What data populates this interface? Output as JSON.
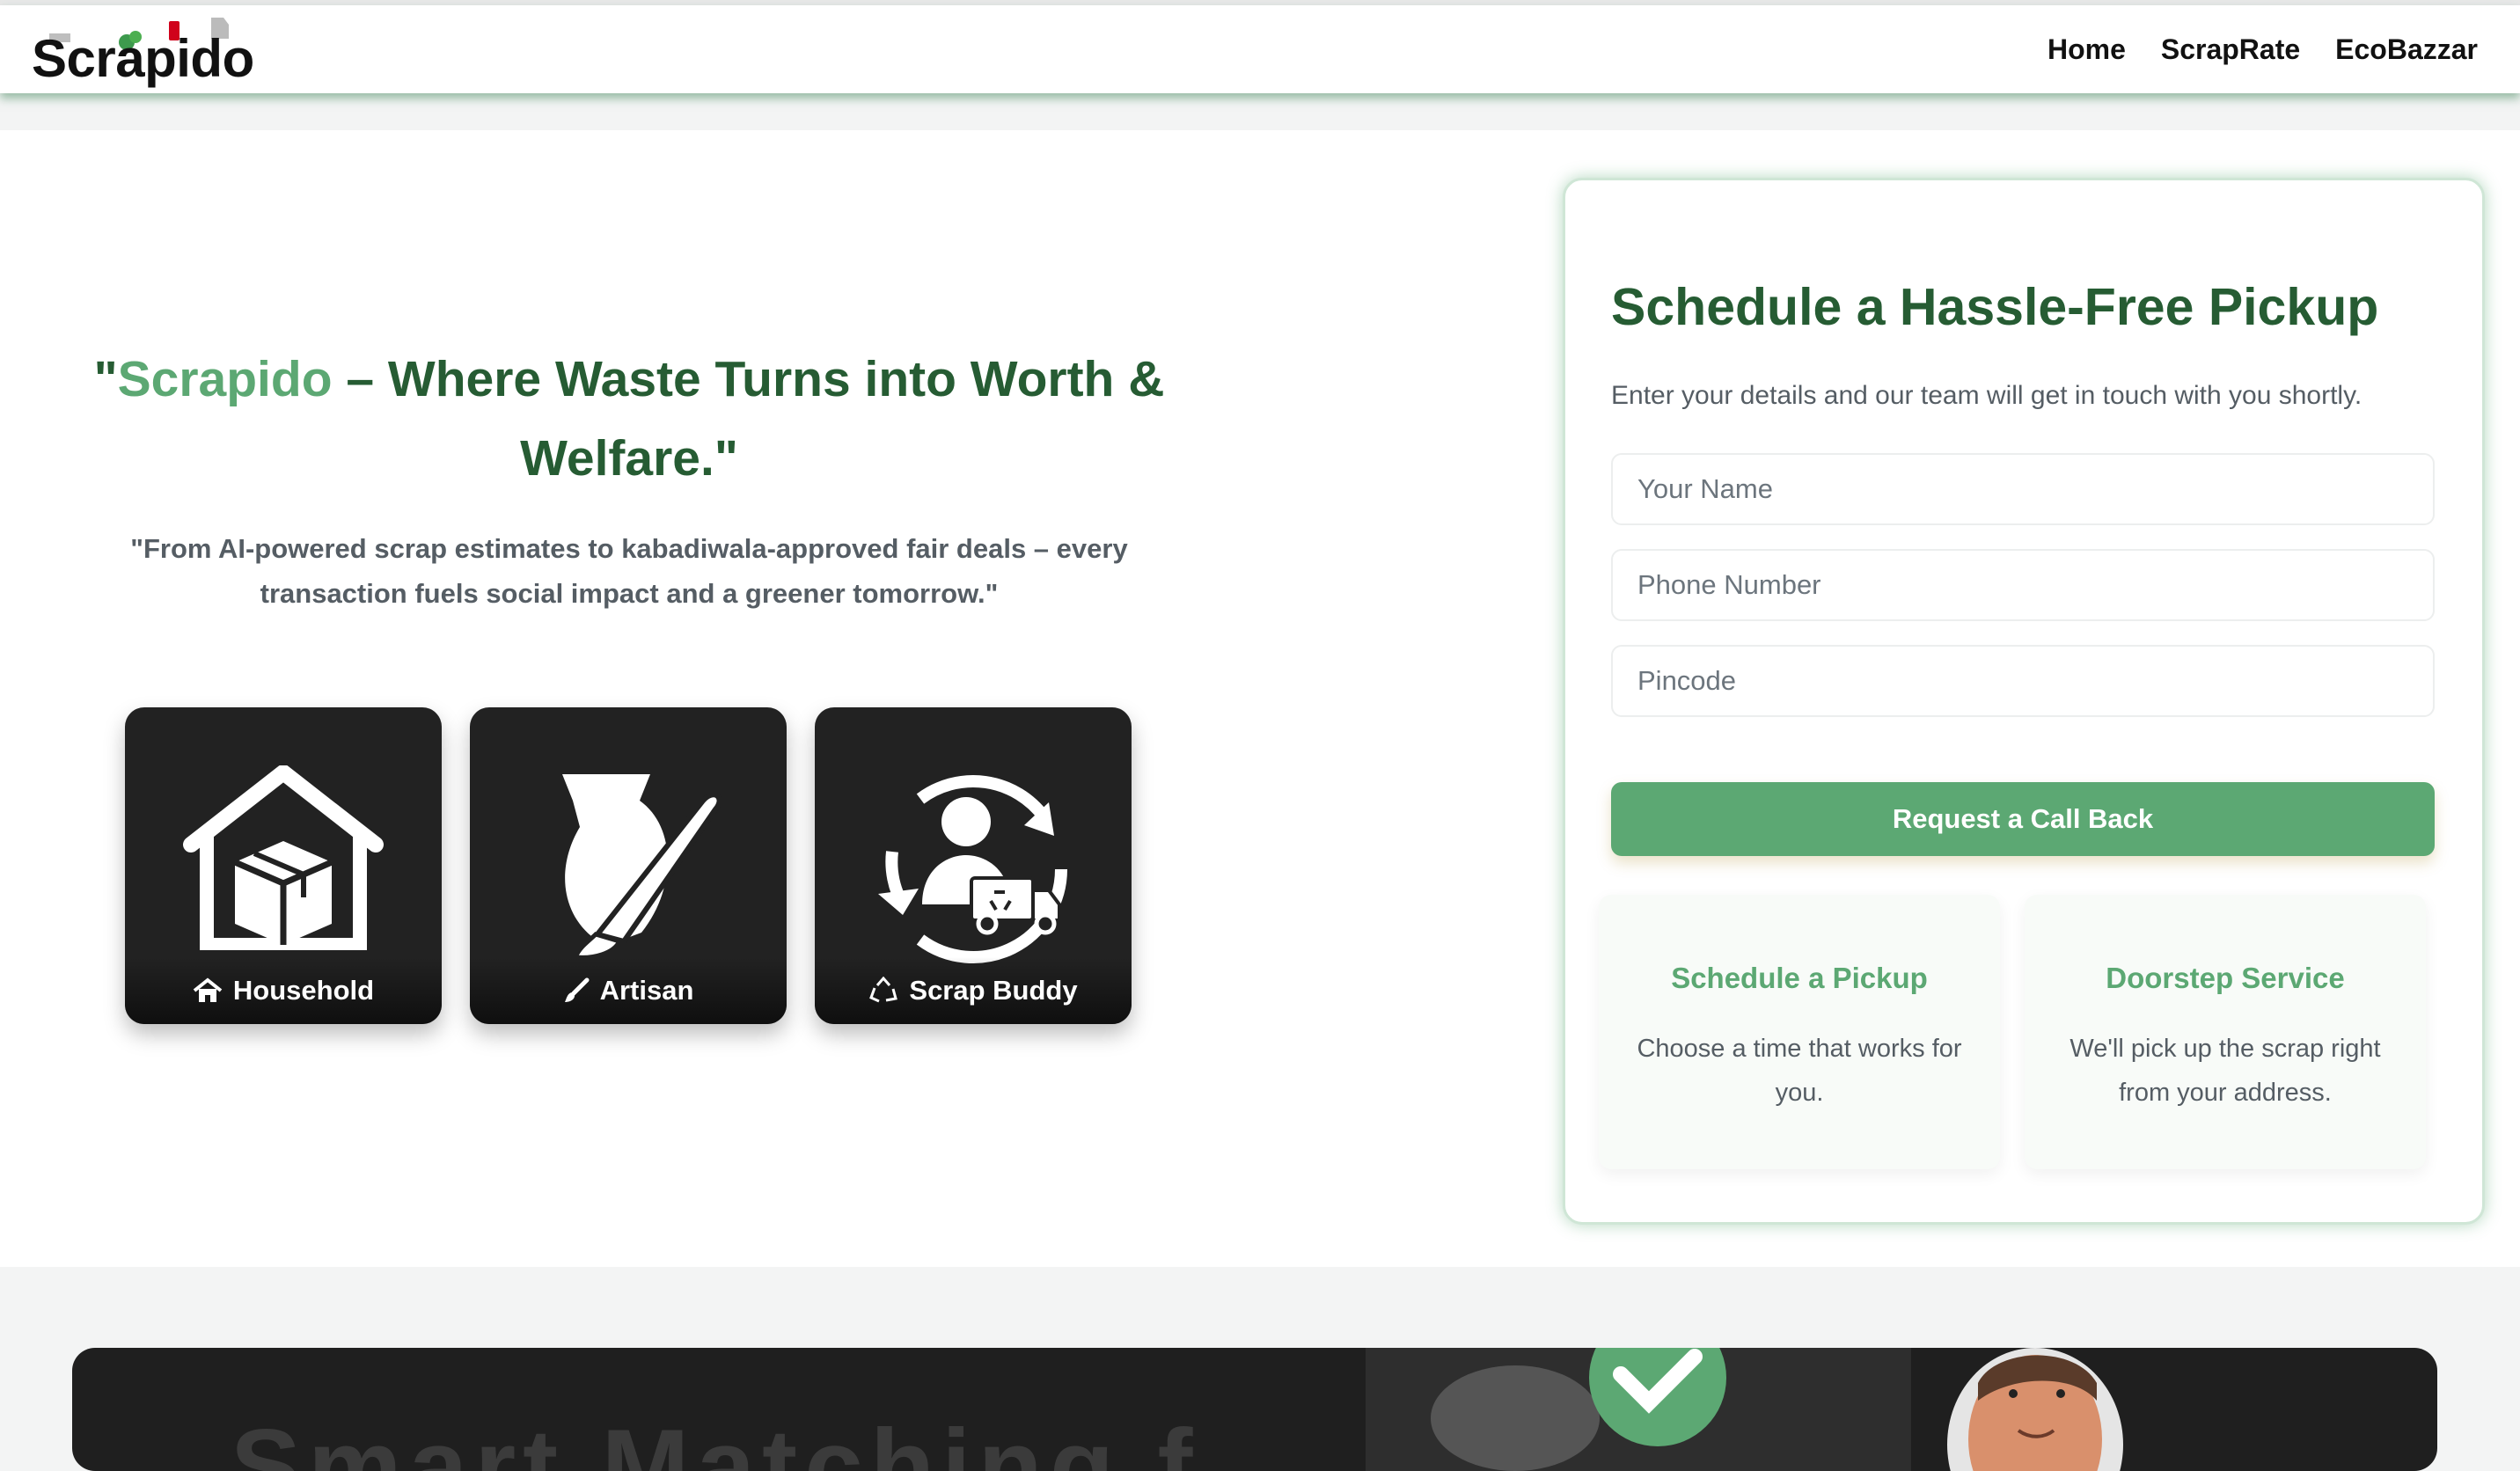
{
  "brand": {
    "logo_text": "Scrapido"
  },
  "nav": {
    "links": [
      {
        "label": "Home"
      },
      {
        "label": "ScrapRate"
      },
      {
        "label": "EcoBazzar"
      }
    ]
  },
  "hero": {
    "headline_open_quote": "\"",
    "headline_brand": "Scrapido",
    "headline_rest": " – Where Waste Turns into Worth & Welfare.\"",
    "subline": "\"From AI-powered scrap estimates to kabadiwala-approved fair deals – every transaction fuels social impact and a greener tomorrow.\"",
    "cards": [
      {
        "label": "Household",
        "icon": "home-icon"
      },
      {
        "label": "Artisan",
        "icon": "paintbrush-icon"
      },
      {
        "label": "Scrap Buddy",
        "icon": "recycle-icon"
      }
    ]
  },
  "form": {
    "title": "Schedule a Hassle-Free Pickup",
    "subtitle": "Enter your details and our team will get in touch with you shortly.",
    "name_placeholder": "Your Name",
    "phone_placeholder": "Phone Number",
    "pincode_placeholder": "Pincode",
    "submit_label": "Request a Call Back",
    "features": [
      {
        "title": "Schedule a Pickup",
        "text": "Choose a time that works for you."
      },
      {
        "title": "Doorstep Service",
        "text": "We'll pick up the scrap right from your address."
      }
    ]
  },
  "banner": {
    "partial_text": "Smart Matching f"
  },
  "colors": {
    "brand_green": "#5ca873",
    "dark_green": "#265c33",
    "muted_text": "#555d64",
    "card_bg": "#222222"
  }
}
